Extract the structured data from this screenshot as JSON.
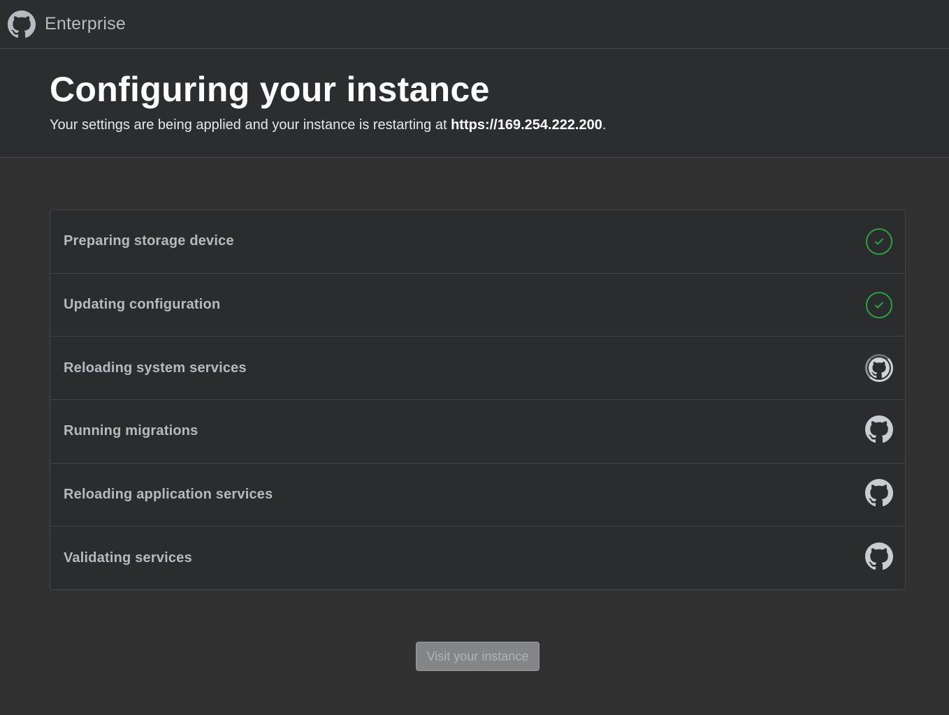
{
  "header": {
    "logo_icon": "github-octocat-icon",
    "brand": "Enterprise"
  },
  "hero": {
    "title": "Configuring your instance",
    "subtitle_prefix": "Your settings are being applied and your instance is restarting at ",
    "url": "https://169.254.222.200",
    "subtitle_suffix": "."
  },
  "steps": [
    {
      "label": "Preparing storage device",
      "status": "complete",
      "icon": "check-circle-icon"
    },
    {
      "label": "Updating configuration",
      "status": "complete",
      "icon": "check-circle-icon"
    },
    {
      "label": "Reloading system services",
      "status": "in-progress",
      "icon": "octocat-spinner-icon"
    },
    {
      "label": "Running migrations",
      "status": "pending",
      "icon": "octocat-icon"
    },
    {
      "label": "Reloading application services",
      "status": "pending",
      "icon": "octocat-icon"
    },
    {
      "label": "Validating services",
      "status": "pending",
      "icon": "octocat-icon"
    }
  ],
  "action": {
    "visit_label": "Visit your instance",
    "disabled": true
  },
  "colors": {
    "background": "#313132",
    "panel": "#2b2c2e",
    "success": "#2ea043",
    "text_muted": "#b6babf"
  }
}
